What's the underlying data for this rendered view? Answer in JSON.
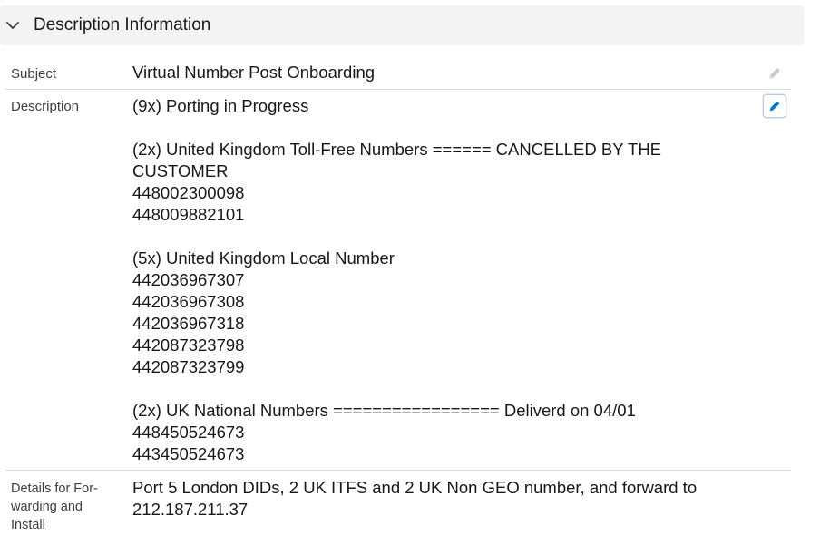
{
  "section": {
    "title": "Description Information",
    "icon": "chevron-down-icon"
  },
  "fields": {
    "subject": {
      "label": "Subject",
      "value": "Virtual Number Post Onboarding",
      "edit_icon": "pencil-icon"
    },
    "description": {
      "label": "Description",
      "lines": [
        "(9x) Porting in Progress",
        "",
        "(2x) United Kingdom Toll-Free Numbers ====== CANCELLED BY THE",
        "CUSTOMER",
        "448002300098",
        "448009882101",
        "",
        "(5x) United Kingdom Local Number",
        "442036967307",
        "442036967308",
        "442036967318",
        "442087323798",
        "442087323799",
        "",
        "(2x) UK National Numbers ================= Deliverd on 04/01",
        "448450524673",
        "443450524673"
      ],
      "edit_icon": "pencil-icon"
    },
    "details": {
      "label_lines": [
        "Details for For-",
        "warding and",
        "Install"
      ],
      "value_lines": [
        "Port 5 London DIDs, 2 UK ITFS and 2 UK Non GEO number, and forward to",
        "212.187.211.37"
      ]
    }
  },
  "colors": {
    "header_bg": "#f3f3f3",
    "label": "#3e3e3c",
    "text": "#181818",
    "divider": "#dddbda",
    "edit_active": "#0176d3",
    "edit_inactive": "#c9c9c9"
  }
}
